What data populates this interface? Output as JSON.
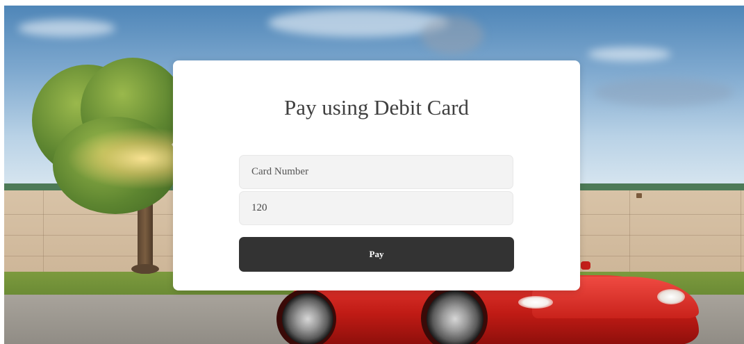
{
  "payment": {
    "title": "Pay using Debit Card",
    "card_number": {
      "placeholder": "Card Number",
      "value": ""
    },
    "amount": {
      "placeholder": "",
      "value": "120"
    },
    "pay_label": "Pay"
  },
  "colors": {
    "button_bg": "#333333",
    "button_text": "#ffffff",
    "card_bg": "#ffffff",
    "field_bg": "#f3f3f3",
    "title_text": "#3f3f3f"
  }
}
